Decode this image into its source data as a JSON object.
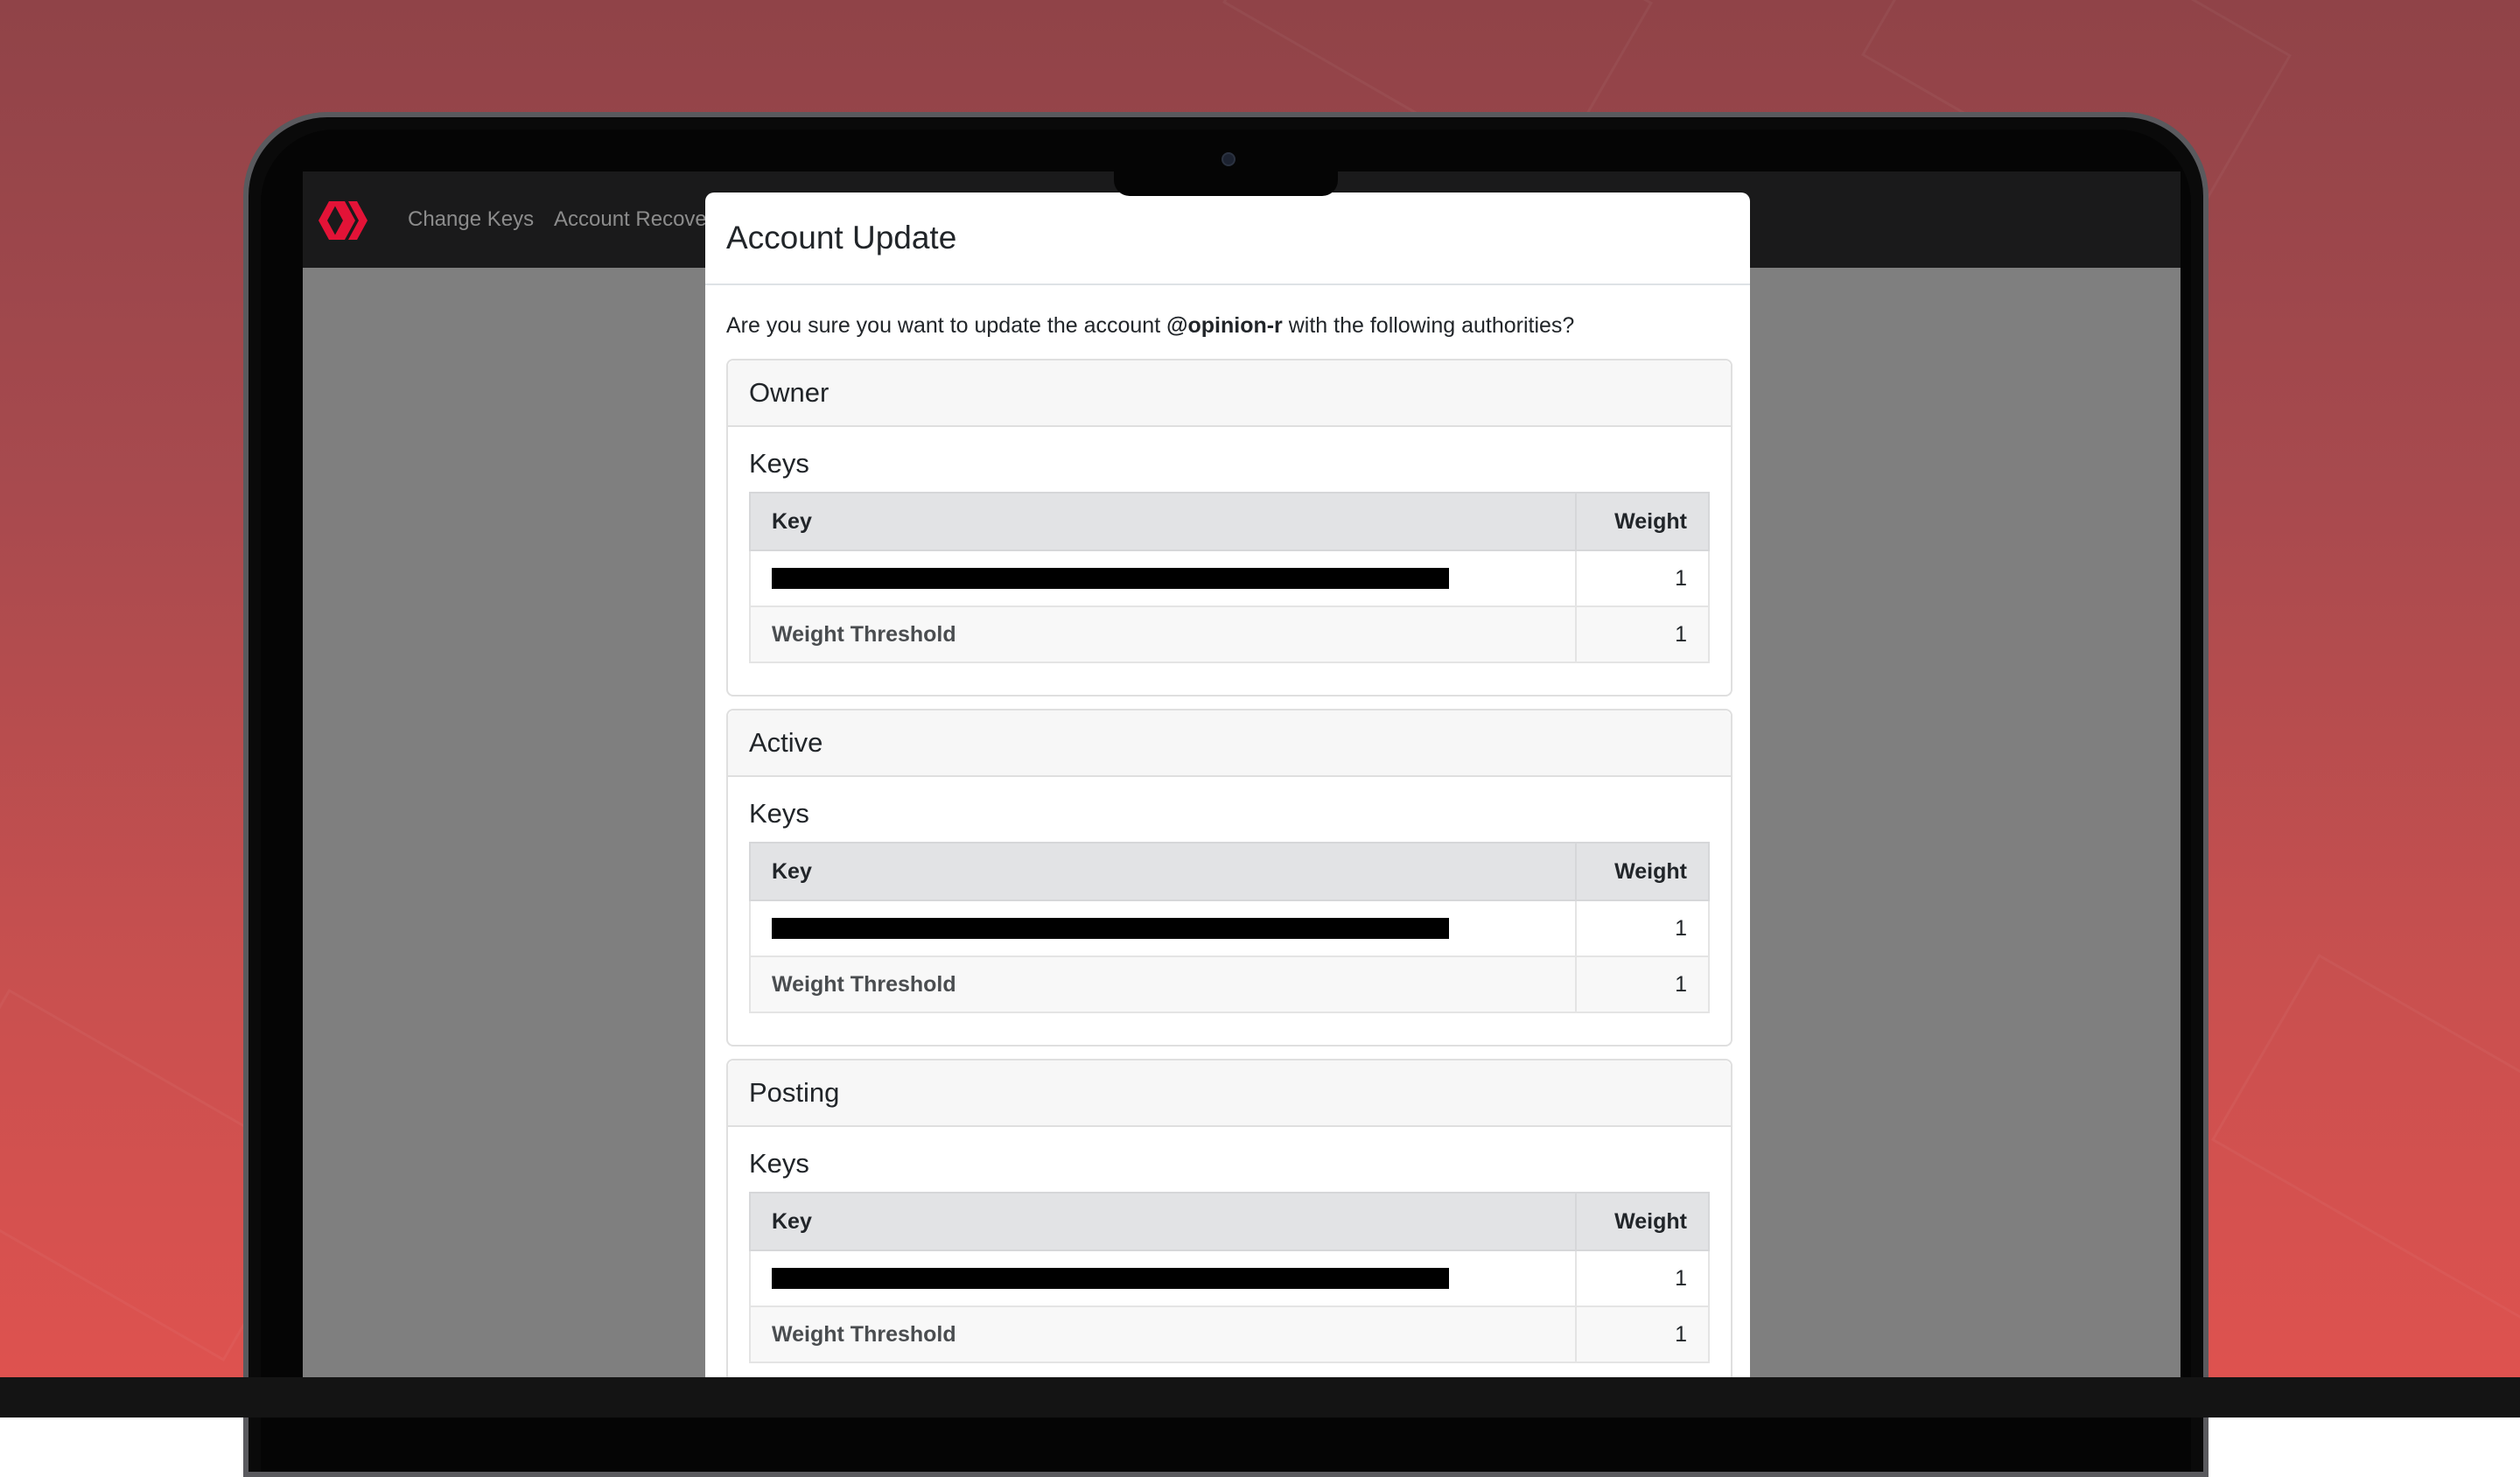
{
  "navbar": {
    "logo_icon": "hive-logo-icon",
    "links": [
      "Change Keys",
      "Account Recovery"
    ]
  },
  "modal": {
    "title": "Account Update",
    "intro_prefix": "Are you sure you want to update the account ",
    "account": "@opinion-r",
    "intro_suffix": " with the following authorities?",
    "sections": [
      {
        "title": "Owner",
        "keys_title": "Keys",
        "col_key": "Key",
        "col_weight": "Weight",
        "key_weight": "1",
        "threshold_label": "Weight Threshold",
        "threshold_value": "1"
      },
      {
        "title": "Active",
        "keys_title": "Keys",
        "col_key": "Key",
        "col_weight": "Weight",
        "key_weight": "1",
        "threshold_label": "Weight Threshold",
        "threshold_value": "1"
      },
      {
        "title": "Posting",
        "keys_title": "Keys",
        "col_key": "Key",
        "col_weight": "Weight",
        "key_weight": "1",
        "threshold_label": "Weight Threshold",
        "threshold_value": "1"
      }
    ]
  },
  "colors": {
    "brand": "#e31337",
    "background_top": "#904348",
    "background_bottom": "#e0524f"
  }
}
